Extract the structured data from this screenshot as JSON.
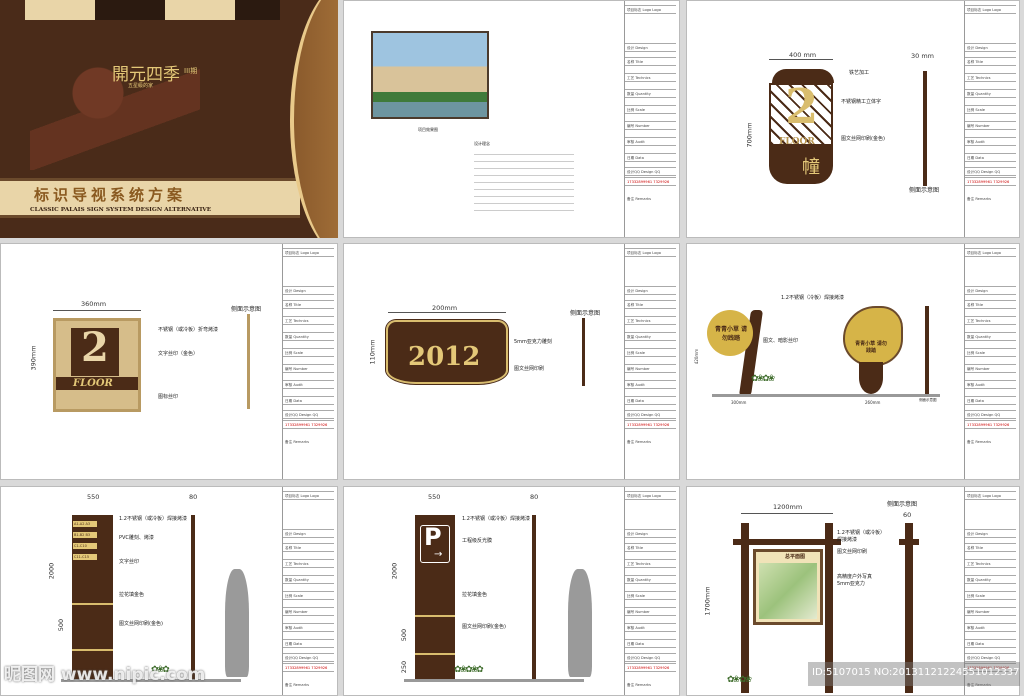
{
  "cover": {
    "logo_name": "開元四季",
    "logo_phase": "III期",
    "logo_slogan": "五星級的家",
    "title_cn": "标识导视系统方案",
    "title_en": "CLASSIC PALAIS SIGN SYSTEM DESIGN ALTERNATIVE"
  },
  "sidebar": {
    "rows": [
      "项目标志 Logo Logo",
      "设计 Design",
      "名称 Title",
      "工艺 Technics",
      "数量 Quantity",
      "比例 Scale",
      "编号 Number",
      "审核 Audit",
      "日期 Data",
      "设计QQ Design QQ"
    ],
    "phone": "17332899961 7329926",
    "remarks_label": "备注 Remarks"
  },
  "sheet2": {
    "photo_caption": "项目效果图",
    "concept_heading": "设计理念"
  },
  "sheet3": {
    "width": "400 mm",
    "height": "700mm",
    "depth": "30 mm",
    "number": "2",
    "floor": "FLOOR",
    "char": "幢",
    "notes": [
      "铁艺加工",
      "不锈钢精工立体字",
      "图文丝网印刷(金色)"
    ],
    "side_view": "侧面示意图"
  },
  "sheet4": {
    "width": "360mm",
    "height": "390mm",
    "number": "2",
    "floor": "FLOOR",
    "notes": [
      "不锈钢（或冷板）折弯烤漆",
      "文字丝印（金色）",
      "图标丝印"
    ],
    "side_view": "侧面示意图"
  },
  "sheet5": {
    "width": "200mm",
    "height": "110mm",
    "number": "2012",
    "notes": [
      "5mm亚克力雕刻",
      "图文丝网印刷"
    ],
    "side_view": "侧面示意图"
  },
  "sheet6": {
    "note_top": "1.2不锈钢（冷板）焊接烤漆",
    "note_mid": "图文、暗影丝印",
    "sign_text": "青青小草 请勿践踏",
    "dim_h": "420mm",
    "dim_w1": "300mm",
    "dim_w2": "260mm",
    "side_view": "侧面示意图"
  },
  "sheet7": {
    "width": "550",
    "depth": "80",
    "height": "2000",
    "base": "500",
    "directory": [
      "A1-A2 A3",
      "B1-B2 B3",
      "C1-C10",
      "C11-C15"
    ],
    "notes": [
      "1.2不锈钢（或冷板）焊接烤漆",
      "PVC雕刻、烤漆",
      "文字丝印",
      "拉花填金色",
      "图文丝网印刷(金色)"
    ]
  },
  "sheet8": {
    "width": "550",
    "depth": "80",
    "height": "2000",
    "base": "500",
    "foot": "250",
    "parking": "P",
    "arrow": "→",
    "notes": [
      "1.2不锈钢（或冷板）焊接烤漆",
      "工程级反光膜",
      "拉花填金色",
      "图文丝网印刷(金色)"
    ]
  },
  "sheet9": {
    "width": "1200mm",
    "height": "1700mm",
    "depth": "60",
    "board_title": "总平面图",
    "notes": [
      "1.2不锈钢（或冷板）焊接烤漆",
      "图文丝网印刷",
      "高精度户外写真 5mm亚克力"
    ],
    "side_view": "侧面示意图"
  },
  "watermark": {
    "left": "昵图网 www.nipic.com",
    "right": "ID:5107015 NO:20131121224551012337"
  },
  "colors": {
    "brown": "#4b2b17",
    "gold": "#e4c878",
    "beige": "#e9d5a8"
  }
}
